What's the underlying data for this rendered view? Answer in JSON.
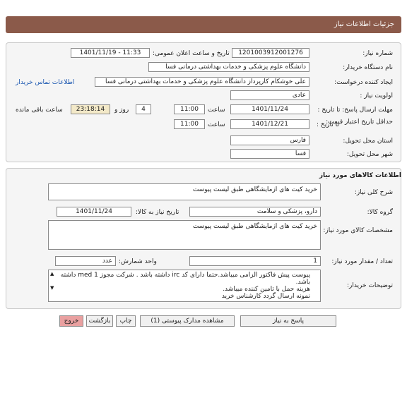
{
  "header": {
    "title": "جزئیات اطلاعات نیاز"
  },
  "info": {
    "need_number_label": "شماره نیاز:",
    "need_number": "1201003912001276",
    "announce_label": "تاریخ و ساعت اعلان عمومی:",
    "announce_value": "1401/11/19 - 11:33",
    "buyer_org_label": "نام دستگاه خریدار:",
    "buyer_org": "دانشگاه علوم پزشکی و خدمات بهداشتی درمانی فسا",
    "requester_label": "ایجاد کننده درخواست:",
    "requester": "علی خوشکام کارپرداز دانشگاه علوم پزشکی و خدمات بهداشتی درمانی فسا",
    "contact_link": "اطلاعات تماس خریدار",
    "priority_label": "اولویت نیاز :",
    "priority": "عادی",
    "reply_deadline_label": "مهلت ارسال پاسخ: تا تاریخ :",
    "reply_date": "1401/11/24",
    "time_label": "ساعت",
    "reply_time": "11:00",
    "days_value": "4",
    "days_label": "روز و",
    "remaining_time": "23:18:14",
    "remaining_label": "ساعت باقی مانده",
    "price_validity_label": "حداقل تاریخ اعتبار قیمت:",
    "to_date_label": "تا تاریخ :",
    "price_date": "1401/12/21",
    "price_time": "11:00",
    "province_label": "استان محل تحویل:",
    "province": "فارس",
    "city_label": "شهر محل تحویل:",
    "city": "فسا"
  },
  "goods": {
    "section_title": "اطلاعات کالاهای مورد نیاز",
    "summary_label": "شرح کلی نیاز:",
    "summary": "خرید کیت های ازمایشگاهی طبق لیست پیوست",
    "group_label": "گروه کالا:",
    "group": "دارو، پزشکی و سلامت",
    "need_date_label": "تاریخ نیاز به کالا:",
    "need_date": "1401/11/24",
    "specs_label": "مشخصات کالای مورد نیاز:",
    "specs": "خرید کیت های ازمایشگاهی طبق لیست پیوست",
    "qty_label": "تعداد / مقدار مورد نیاز:",
    "qty": "1",
    "unit_label": "واحد شمارش:",
    "unit": "عدد",
    "notes_label": "توضیحات خریدار:",
    "notes_line1": "پیوست پیش فاکتور الزامی میباشد.حتما دارای کد irc داشته باشد . شرکت مجوز med 1 داشته باشد.",
    "notes_line2": "هزینه حمل با تامین کننده میباشد.",
    "notes_line3": "نمونه ارسال گردد کارشناس خرید"
  },
  "buttons": {
    "reply": "پاسخ به نیاز",
    "attachments": "مشاهده مدارک پیوستی (1)",
    "print": "چاپ",
    "back": "بازگشت",
    "exit": "خروج"
  }
}
